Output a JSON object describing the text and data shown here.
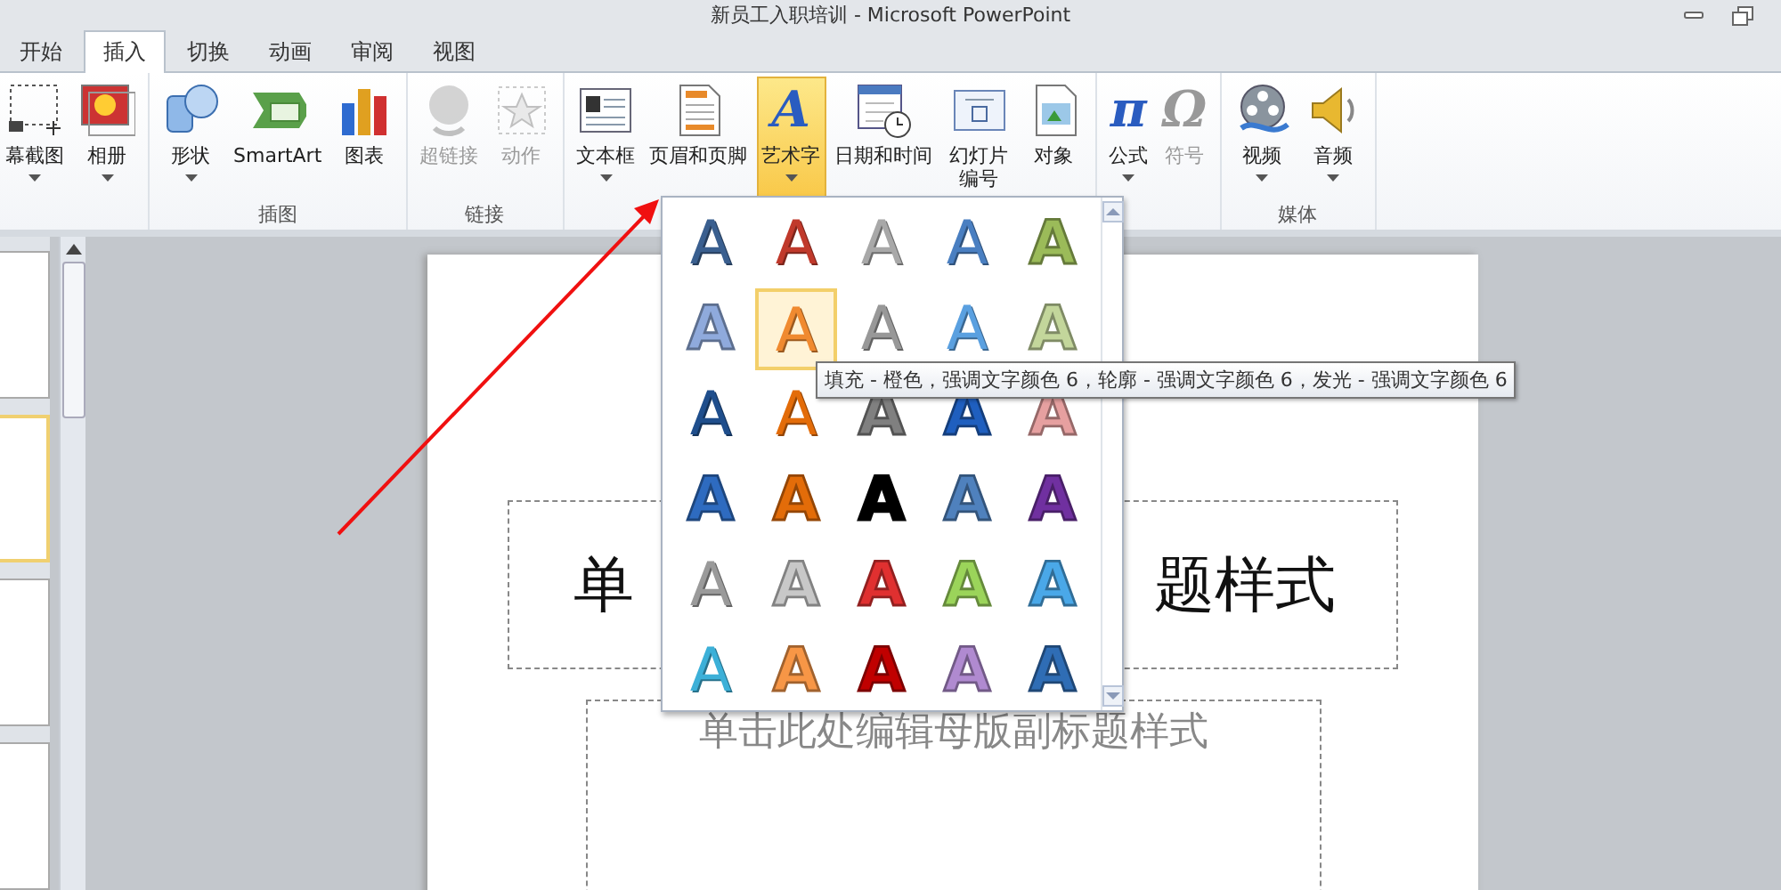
{
  "window": {
    "title": "新员工入职培训  -  Microsoft PowerPoint"
  },
  "tabs": [
    {
      "label": "开始",
      "selected": false
    },
    {
      "label": "插入",
      "selected": true
    },
    {
      "label": "切换",
      "selected": false
    },
    {
      "label": "动画",
      "selected": false
    },
    {
      "label": "审阅",
      "selected": false
    },
    {
      "label": "视图",
      "selected": false
    }
  ],
  "ribbon": {
    "groups": [
      {
        "buttons": [
          {
            "label": "幕截图",
            "disabled": false,
            "selected": false,
            "dropdown": true
          },
          {
            "label": "相册",
            "disabled": false,
            "selected": false,
            "dropdown": true
          }
        ]
      },
      {
        "label": "插图",
        "buttons": [
          {
            "label": "形状",
            "disabled": false,
            "selected": false,
            "dropdown": true
          },
          {
            "label": "SmartArt",
            "disabled": false,
            "selected": false,
            "dropdown": false
          },
          {
            "label": "图表",
            "disabled": false,
            "selected": false,
            "dropdown": false
          }
        ]
      },
      {
        "label": "链接",
        "buttons": [
          {
            "label": "超链接",
            "disabled": true,
            "selected": false,
            "dropdown": false
          },
          {
            "label": "动作",
            "disabled": true,
            "selected": false,
            "dropdown": false
          }
        ]
      },
      {
        "buttons": [
          {
            "label": "文本框",
            "disabled": false,
            "selected": false,
            "dropdown": true
          },
          {
            "label": "页眉和页脚",
            "disabled": false,
            "selected": false,
            "dropdown": false
          },
          {
            "label": "艺术字",
            "glyph": "A",
            "disabled": false,
            "selected": true,
            "dropdown": true
          },
          {
            "label": "日期和时间",
            "disabled": false,
            "selected": false,
            "dropdown": false
          },
          {
            "label": "幻灯片编号",
            "disabled": false,
            "selected": false,
            "dropdown": false
          },
          {
            "label": "对象",
            "disabled": false,
            "selected": false,
            "dropdown": false
          }
        ]
      },
      {
        "buttons": [
          {
            "label": "公式",
            "glyph": "π",
            "disabled": false,
            "selected": false,
            "dropdown": true
          },
          {
            "label": "符号",
            "glyph": "Ω",
            "disabled": true,
            "selected": false,
            "dropdown": false
          }
        ]
      },
      {
        "label": "媒体",
        "buttons": [
          {
            "label": "视频",
            "disabled": false,
            "selected": false,
            "dropdown": true
          },
          {
            "label": "音频",
            "disabled": false,
            "selected": false,
            "dropdown": true
          }
        ]
      }
    ]
  },
  "slide": {
    "title_left": "单",
    "title_right": "题样式",
    "subtitle": "单击此处编辑母版副标题样式"
  },
  "thumbnails": [
    {
      "selected": false
    },
    {
      "selected": true
    },
    {
      "selected": false
    },
    {
      "selected": false
    }
  ],
  "wordart_gallery": {
    "items": [
      {
        "letter": "A",
        "kind": "outline",
        "color": "#3a5f8f",
        "selected": false
      },
      {
        "letter": "A",
        "kind": "outline",
        "color": "#c0392b",
        "selected": false
      },
      {
        "letter": "A",
        "kind": "outline",
        "color": "#a8a8a8",
        "selected": false
      },
      {
        "letter": "A",
        "kind": "outline",
        "color": "#4a7fc1",
        "selected": false
      },
      {
        "letter": "A",
        "kind": "filled",
        "color": "#9bbb59",
        "selected": false
      },
      {
        "letter": "A",
        "kind": "filled",
        "color": "#8faadc",
        "selected": false
      },
      {
        "letter": "A",
        "kind": "outline",
        "color": "#f08a30",
        "selected": true
      },
      {
        "letter": "A",
        "kind": "outline",
        "color": "#989898",
        "selected": false
      },
      {
        "letter": "A",
        "kind": "outline",
        "color": "#5aa0e0",
        "selected": false
      },
      {
        "letter": "A",
        "kind": "filled",
        "color": "#c3d69b",
        "selected": false
      },
      {
        "letter": "A",
        "kind": "outline",
        "color": "#1f4e8c",
        "selected": false
      },
      {
        "letter": "A",
        "kind": "outline",
        "color": "#e36c09",
        "selected": false
      },
      {
        "letter": "A",
        "kind": "filled",
        "color": "#808080",
        "selected": false
      },
      {
        "letter": "A",
        "kind": "filled",
        "color": "#1f5fbf",
        "selected": false
      },
      {
        "letter": "A",
        "kind": "filled",
        "color": "#e6a0a0",
        "selected": false
      },
      {
        "letter": "A",
        "kind": "filled",
        "color": "#2e6bc0",
        "selected": false
      },
      {
        "letter": "A",
        "kind": "filled",
        "color": "#e36c09",
        "selected": false
      },
      {
        "letter": "A",
        "kind": "filled",
        "color": "#000000",
        "selected": false
      },
      {
        "letter": "A",
        "kind": "filled",
        "color": "#4f81bd",
        "selected": false
      },
      {
        "letter": "A",
        "kind": "filled",
        "color": "#7030a0",
        "selected": false
      },
      {
        "letter": "A",
        "kind": "outline",
        "color": "#9a9a9a",
        "selected": false
      },
      {
        "letter": "A",
        "kind": "filled",
        "color": "#c8c8c8",
        "selected": false
      },
      {
        "letter": "A",
        "kind": "filled",
        "color": "#e03030",
        "selected": false
      },
      {
        "letter": "A",
        "kind": "filled",
        "color": "#9bd45a",
        "selected": false
      },
      {
        "letter": "A",
        "kind": "filled",
        "color": "#4aa8e8",
        "selected": false
      },
      {
        "letter": "A",
        "kind": "outline",
        "color": "#3cb0d8",
        "selected": false
      },
      {
        "letter": "A",
        "kind": "filled",
        "color": "#f79646",
        "selected": false
      },
      {
        "letter": "A",
        "kind": "filled",
        "color": "#c00000",
        "selected": false
      },
      {
        "letter": "A",
        "kind": "filled",
        "color": "#b08ad0",
        "selected": false
      },
      {
        "letter": "A",
        "kind": "filled",
        "color": "#2f6db5",
        "selected": false
      }
    ],
    "tooltip": "填充 - 橙色，强调文字颜色 6，轮廓 - 强调文字颜色 6，发光 - 强调文字颜色 6"
  }
}
